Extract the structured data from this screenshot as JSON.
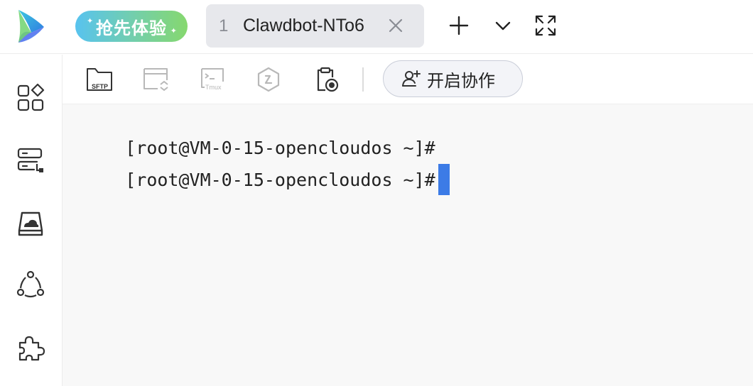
{
  "header": {
    "badge_label": "抢先体验",
    "tab": {
      "number": "1",
      "title": "Clawdbot-NTo6"
    }
  },
  "toolbar": {
    "sftp_label": "SFTP",
    "tmux_label": "Tmux",
    "collab_label": "开启协作"
  },
  "terminal": {
    "lines": [
      "[root@VM-0-15-opencloudos ~]#",
      "[root@VM-0-15-opencloudos ~]#"
    ]
  },
  "colors": {
    "cursor": "#3c7be6",
    "badge_start": "#58c3ef",
    "badge_end": "#86d86e",
    "tab_bg": "#e7e8ec"
  },
  "icons": {
    "logo": "app-logo",
    "new_tab": "plus-icon",
    "tab_menu": "chevron-down-icon",
    "fullscreen": "fullscreen-icon",
    "sidebar": [
      "apps-grid-icon",
      "server-list-icon",
      "cloud-drive-icon",
      "share-network-icon",
      "plugin-icon"
    ]
  }
}
